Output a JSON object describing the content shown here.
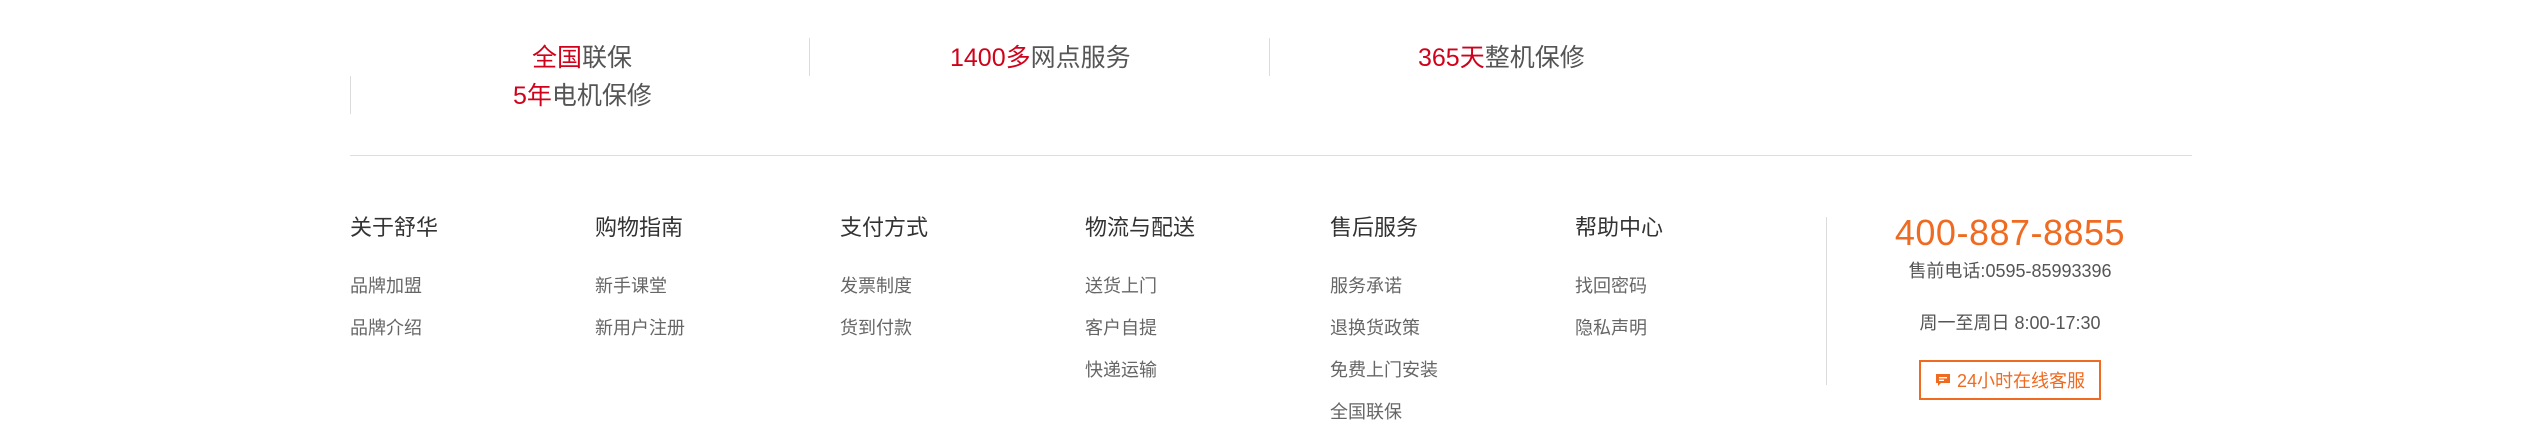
{
  "promo": [
    {
      "highlight": "全国",
      "text": "联保"
    },
    {
      "highlight": "1400多",
      "text": "网点服务"
    },
    {
      "highlight": "365天",
      "text": "整机保修"
    },
    {
      "highlight": "5年",
      "text": "电机保修"
    }
  ],
  "footer_columns": [
    {
      "title": "关于舒华",
      "links": [
        "品牌加盟",
        "品牌介绍"
      ]
    },
    {
      "title": "购物指南",
      "links": [
        "新手课堂",
        "新用户注册"
      ]
    },
    {
      "title": "支付方式",
      "links": [
        "发票制度",
        "货到付款"
      ]
    },
    {
      "title": "物流与配送",
      "links": [
        "送货上门",
        "客户自提",
        "快递运输"
      ]
    },
    {
      "title": "售后服务",
      "links": [
        "服务承诺",
        "退换货政策",
        "免费上门安装",
        "全国联保"
      ]
    },
    {
      "title": "帮助中心",
      "links": [
        "找回密码",
        "隐私声明"
      ]
    }
  ],
  "contact": {
    "hotline": "400-887-8855",
    "presale": "售前电话:0595-85993396",
    "hours": "周一至周日 8:00-17:30",
    "service_button": "24小时在线客服",
    "service_icon": "chat-bubble-icon"
  },
  "colors": {
    "accent_red": "#d0021b",
    "accent_orange": "#ee6b21"
  }
}
